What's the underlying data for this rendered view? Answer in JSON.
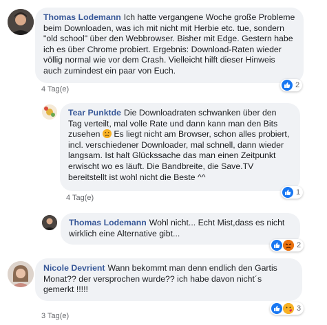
{
  "comments": [
    {
      "author": "Thomas Lodemann",
      "text": "Ich hatte vergangene Woche große Probleme beim Downloaden, was ich mit nicht mit Herbie etc. tue, sondern \"old school\" über den Webbrowser. Bisher mit Edge. Gestern habe ich es über Chrome probiert. Ergebnis: Download-Raten wieder völlig normal wie vor dem Crash. Vielleicht hilft dieser Hinweis auch zumindest ein paar von Euch.",
      "time": "4 Tag(e)",
      "reactions": [
        "like"
      ],
      "reaction_count": "2"
    },
    {
      "author": "Tear Punktde",
      "text_before_emoji": "Die Downloadraten schwanken über den Tag verteilt, mal volle Rate und dann kann man den Bits zusehen ",
      "text_after_emoji": " Es liegt nicht am Browser, schon alles probiert, incl. verschiedener Downloader, mal schnell, dann wieder langsam. Ist halt Glückssache das man einen Zeitpunkt erwischt wo es läuft. Die Bandbreite, die Save.TV bereitstellt ist wohl nicht die Beste ^^",
      "time": "4 Tag(e)",
      "reactions": [
        "like"
      ],
      "reaction_count": "1"
    },
    {
      "author": "Thomas Lodemann",
      "text": "Wohl nicht... Echt Mist,dass es nicht wirklich eine Alternative gibt...",
      "time": "",
      "reactions": [
        "like",
        "angry"
      ],
      "reaction_count": "2"
    },
    {
      "author": "Nicole Devrient",
      "text": "Wann bekommt man denn endlich den Gartis Monat?? der versprochen wurde?? ich habe davon nicht´s gemerkt !!!!!",
      "time": "3 Tag(e)",
      "reactions": [
        "like",
        "care"
      ],
      "reaction_count": "3"
    }
  ]
}
